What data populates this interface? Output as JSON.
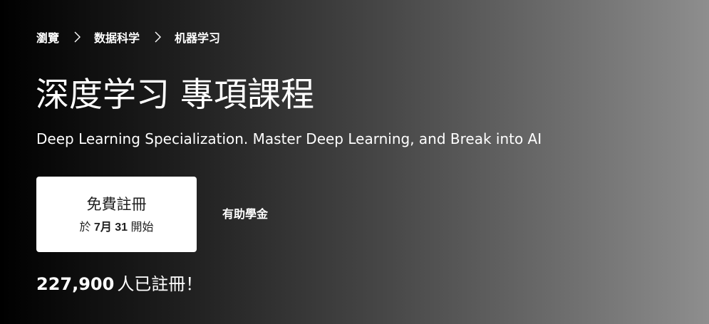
{
  "breadcrumb": {
    "items": [
      {
        "label": "瀏覽"
      },
      {
        "label": "数据科学"
      },
      {
        "label": "机器学习"
      }
    ],
    "separator_icon": "chevron-right-icon"
  },
  "course": {
    "title": "深度学习 專項課程",
    "subtitle": "Deep Learning Specialization. Master Deep Learning, and Break into AI"
  },
  "enroll": {
    "label": "免費註冊",
    "date_prefix": "於",
    "date_month": "7月",
    "date_day": "31",
    "date_suffix": "開始"
  },
  "financial_aid": {
    "label": "有助學金"
  },
  "enrollment": {
    "count": "227,900",
    "label": "人已註冊！"
  },
  "colors": {
    "gradient_start": "#000000",
    "gradient_end": "#8e8e8e",
    "button_bg": "#ffffff",
    "button_text": "#1f1f1f",
    "text": "#ffffff"
  }
}
